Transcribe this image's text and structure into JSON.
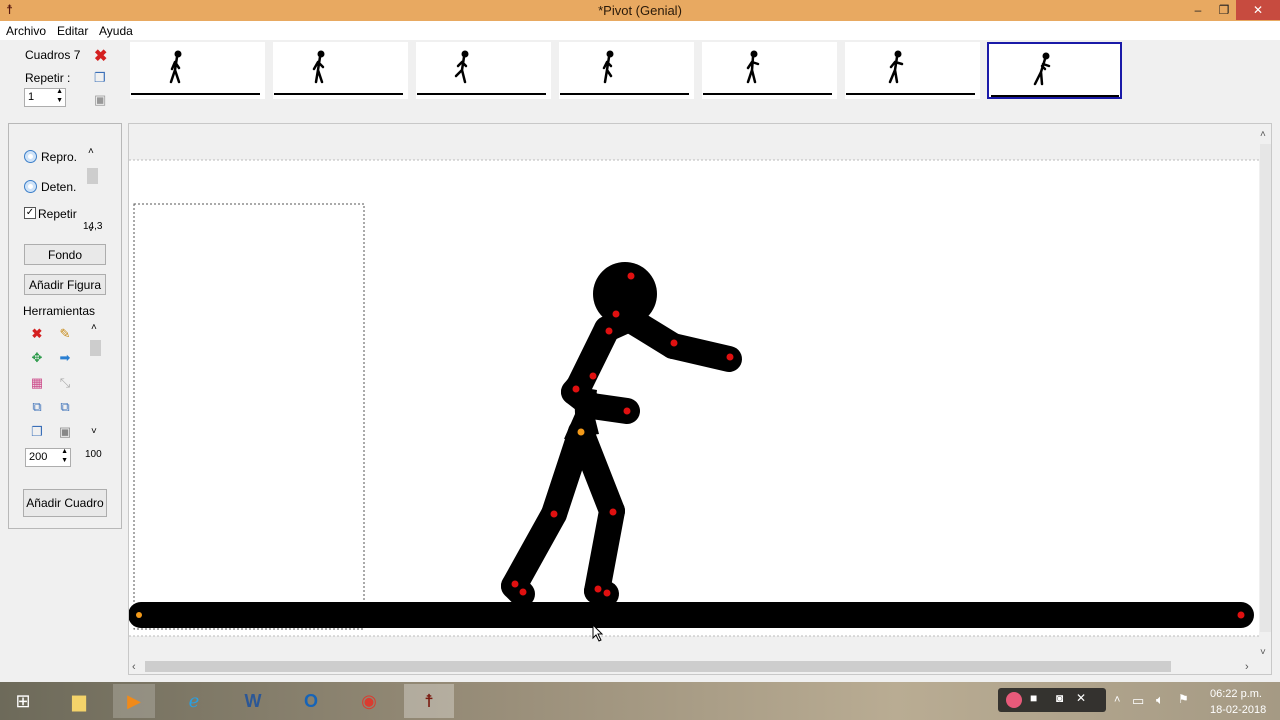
{
  "window": {
    "title": "*Pivot (Genial)",
    "app_icon": "stickfigure-icon",
    "minimize": "‒",
    "restore": "❐",
    "close": "✕"
  },
  "menu": [
    "Archivo",
    "Editar",
    "Ayuda"
  ],
  "frames": {
    "count_label": "Cuadros 7",
    "repeat_label": "Repetir :",
    "repeat_value": "1",
    "selected_index": 6
  },
  "playback": {
    "play_label": "Repro.",
    "stop_label": "Deten.",
    "repeat_label": "Repetir",
    "repeat_checked": true,
    "speed_value": "14,3"
  },
  "buttons": {
    "background": "Fondo",
    "add_figure": "Añadir Figura",
    "add_frame": "Añadir Cuadro"
  },
  "tools": {
    "title": "Herramientas",
    "size_value": "200",
    "opacity_value": "100",
    "icons": [
      "delete-icon",
      "edit-icon",
      "center-icon",
      "flip-icon",
      "color-icon",
      "scale-icon",
      "front-icon",
      "back-icon",
      "copy-icon",
      "paste-icon"
    ]
  },
  "taskbar": {
    "apps": [
      "file-explorer-icon",
      "media-player-icon",
      "internet-explorer-icon",
      "word-icon",
      "outlook-icon",
      "chrome-icon",
      "pivot-icon"
    ],
    "time": "06:22 p.m.",
    "date": "18-02-2018"
  },
  "colors": {
    "titlebar": "#e8a961",
    "handle_red": "#e01010",
    "handle_orange": "#f39a1a",
    "selected_frame": "#1a1aa8"
  }
}
